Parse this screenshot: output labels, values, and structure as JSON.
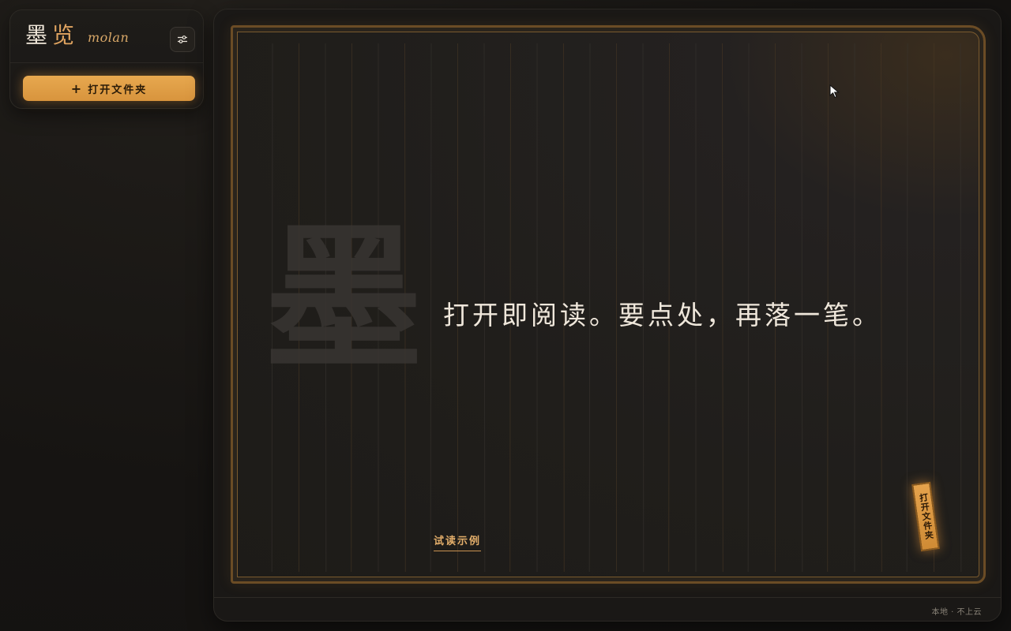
{
  "sidebar": {
    "brand_char1": "墨",
    "brand_char2": "览",
    "brand_sub": "molan",
    "settings_icon": "sliders-icon",
    "open_folder_label": "打开文件夹",
    "open_folder_plus": "+"
  },
  "main": {
    "watermark_glyph": "墨",
    "tagline": "打开即阅读。要点处，再落一笔。",
    "sample_link": "试读示例",
    "seal_label": "打开文件夹",
    "footer_status": "本地 · 不上云"
  },
  "colors": {
    "accent": "#e0a460",
    "button": "#dd9c45",
    "background": "#161412",
    "text": "#efe7db"
  }
}
